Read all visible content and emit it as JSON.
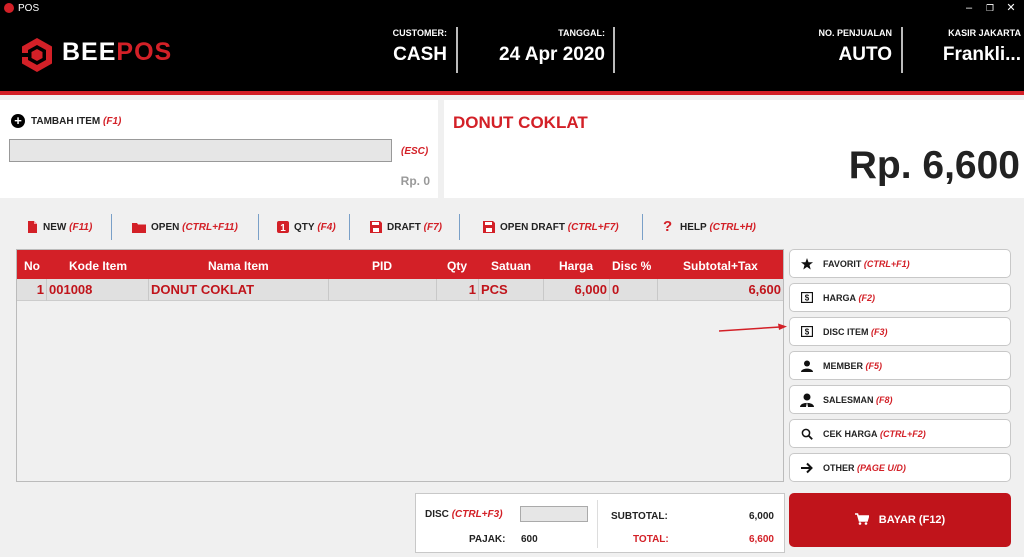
{
  "window": {
    "title": "POS"
  },
  "header": {
    "logo_bee": "BEE",
    "logo_pos": "POS",
    "customer_label": "CUSTOMER:",
    "customer_value": "CASH",
    "date_label": "TANGGAL:",
    "date_value": "24 Apr 2020",
    "sale_no_label": "NO. PENJUALAN",
    "sale_no_value": "AUTO",
    "cashier_label": "KASIR JAKARTA",
    "cashier_value": "Frankli..."
  },
  "input_panel": {
    "add_label": "TAMBAH ITEM",
    "add_shortcut": "(F1)",
    "search_value": "",
    "esc_hint": "(ESC)",
    "price_small": "Rp. 0"
  },
  "display": {
    "item_name": "DONUT COKLAT",
    "price": "Rp. 6,600"
  },
  "toolbar": [
    {
      "label": "NEW",
      "shortcut": "(F11)",
      "icon": "file-icon"
    },
    {
      "label": "OPEN",
      "shortcut": "(CTRL+F11)",
      "icon": "folder-icon"
    },
    {
      "label": "QTY",
      "shortcut": "(F4)",
      "icon": "qty-icon"
    },
    {
      "label": "DRAFT",
      "shortcut": "(F7)",
      "icon": "save-icon"
    },
    {
      "label": "OPEN DRAFT",
      "shortcut": "(CTRL+F7)",
      "icon": "save-icon"
    },
    {
      "label": "HELP",
      "shortcut": "(CTRL+H)",
      "icon": "help-icon"
    }
  ],
  "table": {
    "headers": [
      "No",
      "Kode Item",
      "Nama Item",
      "PID",
      "Qty",
      "Satuan",
      "Harga",
      "Disc %",
      "Subtotal+Tax"
    ],
    "rows": [
      [
        "1",
        "001008",
        "DONUT COKLAT",
        "",
        "1",
        "PCS",
        "6,000",
        "0",
        "6,600"
      ]
    ]
  },
  "side_buttons": [
    {
      "label": "FAVORIT",
      "shortcut": "(CTRL+F1)",
      "icon": "star-icon"
    },
    {
      "label": "HARGA",
      "shortcut": "(F2)",
      "icon": "dollar-icon"
    },
    {
      "label": "DISC ITEM",
      "shortcut": "(F3)",
      "icon": "dollar-icon"
    },
    {
      "label": "MEMBER",
      "shortcut": "(F5)",
      "icon": "person-icon"
    },
    {
      "label": "SALESMAN",
      "shortcut": "(F8)",
      "icon": "salesman-icon"
    },
    {
      "label": "CEK HARGA",
      "shortcut": "(CTRL+F2)",
      "icon": "search-icon"
    },
    {
      "label": "OTHER",
      "shortcut": "(PAGE U/D)",
      "icon": "arrow-right-icon"
    }
  ],
  "summary": {
    "disc_label": "DISC",
    "disc_shortcut": "(CTRL+F3)",
    "disc_value": "",
    "pajak_label": "PAJAK:",
    "pajak_value": "600",
    "subtotal_label": "SUBTOTAL:",
    "subtotal_value": "6,000",
    "total_label": "TOTAL:",
    "total_value": "6,600"
  },
  "bayar": {
    "label": "BAYAR (F12)"
  },
  "colors": {
    "brand_red": "#d32027",
    "header_bg": "#000000"
  }
}
